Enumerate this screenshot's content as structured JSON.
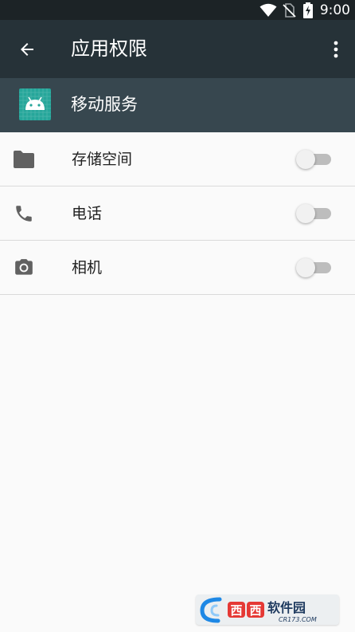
{
  "status_bar": {
    "time": "9:00",
    "icons": [
      "wifi-icon",
      "no-sim-icon",
      "battery-charging-icon"
    ]
  },
  "app_bar": {
    "title": "应用权限",
    "back_icon": "arrow-back-icon",
    "menu_icon": "more-vert-icon",
    "background_color": "#263238"
  },
  "app_header": {
    "app_name": "移动服务",
    "app_icon": "android-icon",
    "icon_color": "#26a69a",
    "background_color": "#37474f"
  },
  "permissions": [
    {
      "label": "存储空间",
      "icon": "folder-icon",
      "enabled": false
    },
    {
      "label": "电话",
      "icon": "phone-icon",
      "enabled": false
    },
    {
      "label": "相机",
      "icon": "camera-icon",
      "enabled": false
    }
  ],
  "watermark": {
    "brand": "西西软件园",
    "url": "CR173.COM"
  }
}
